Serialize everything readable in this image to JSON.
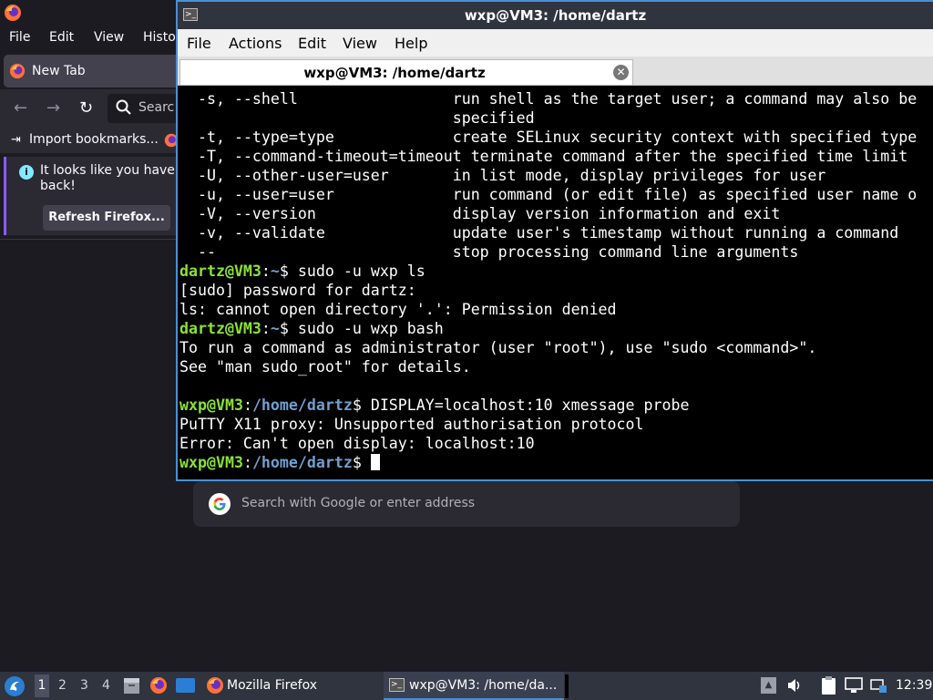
{
  "firefox": {
    "menu": [
      "File",
      "Edit",
      "View",
      "Histo"
    ],
    "tab_label": "New Tab",
    "url_placeholder": "Searc",
    "import_bookmarks": "Import bookmarks...",
    "notice_line1": "It looks like you haven",
    "notice_line2": "back!",
    "refresh_button": "Refresh Firefox...",
    "search_placeholder": "Search with Google or enter address"
  },
  "terminal": {
    "window_title": "wxp@VM3: /home/dartz",
    "menu": [
      "File",
      "Actions",
      "Edit",
      "View",
      "Help"
    ],
    "tab_title": "wxp@VM3: /home/dartz",
    "lines": [
      {
        "text": "  -s, --shell                 run shell as the target user; a command may also be"
      },
      {
        "text": "                              specified"
      },
      {
        "text": "  -t, --type=type             create SELinux security context with specified type"
      },
      {
        "text": "  -T, --command-timeout=timeout terminate command after the specified time limit"
      },
      {
        "text": "  -U, --other-user=user       in list mode, display privileges for user"
      },
      {
        "text": "  -u, --user=user             run command (or edit file) as specified user name o"
      },
      {
        "text": "  -V, --version               display version information and exit"
      },
      {
        "text": "  -v, --validate              update user's timestamp without running a command"
      },
      {
        "text": "  --                          stop processing command line arguments"
      },
      {
        "user": "dartz@VM3",
        "path": "~",
        "cmd": "$ sudo -u wxp ls"
      },
      {
        "text": "[sudo] password for dartz:"
      },
      {
        "text": "ls: cannot open directory '.': Permission denied"
      },
      {
        "user": "dartz@VM3",
        "path": "~",
        "cmd": "$ sudo -u wxp bash"
      },
      {
        "text": "To run a command as administrator (user \"root\"), use \"sudo <command>\"."
      },
      {
        "text": "See \"man sudo_root\" for details."
      },
      {
        "text": ""
      },
      {
        "user": "wxp@VM3",
        "path": "/home/dartz",
        "cmd": "$ DISPLAY=localhost:10 xmessage probe"
      },
      {
        "text": "PuTTY X11 proxy: Unsupported authorisation protocol"
      },
      {
        "text": "Error: Can't open display: localhost:10"
      },
      {
        "user": "wxp@VM3",
        "path": "/home/dartz",
        "cmd": "$ ",
        "cursor": true
      }
    ]
  },
  "taskbar": {
    "workspaces": [
      "1",
      "2",
      "3",
      "4"
    ],
    "task_firefox": "Mozilla Firefox",
    "task_terminal": "wxp@VM3: /home/da...",
    "clock": "12:39"
  },
  "colors": {
    "prompt_user": "#8ae234",
    "prompt_path": "#729fcf",
    "terminal_bg": "#000000",
    "focus_accent": "#4a90d9"
  }
}
